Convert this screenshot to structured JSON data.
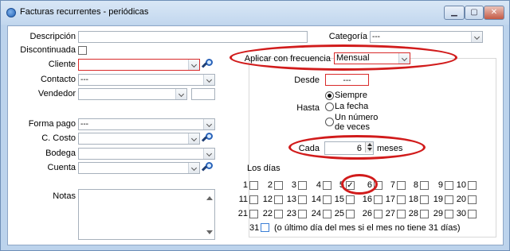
{
  "window": {
    "title": "Facturas recurrentes - periódicas"
  },
  "form": {
    "descripcion_label": "Descripción",
    "categoria_label": "Categoría",
    "categoria_value": "---",
    "discontinuada_label": "Discontinuada",
    "cliente_label": "Cliente",
    "contacto_label": "Contacto",
    "contacto_value": "---",
    "vendedor_label": "Vendedor",
    "forma_pago_label": "Forma pago",
    "forma_pago_value": "---",
    "costo_label": "C. Costo",
    "bodega_label": "Bodega",
    "cuenta_label": "Cuenta",
    "notas_label": "Notas"
  },
  "recurrence": {
    "frecuencia_label": "Aplicar con frecuencia",
    "frecuencia_value": "Mensual",
    "desde_label": "Desde",
    "desde_value": "---",
    "hasta_label": "Hasta",
    "opt_siempre": "Siempre",
    "opt_fecha": "La fecha",
    "opt_numero_1": "Un número",
    "opt_numero_2": "de veces",
    "cada_label": "Cada",
    "cada_value": "6",
    "cada_unit": "meses",
    "dias_label": "Los días",
    "days_row1": [
      "1",
      "2",
      "3",
      "4",
      "5",
      "6",
      "7",
      "8",
      "9",
      "10"
    ],
    "days_row2": [
      "11",
      "12",
      "13",
      "14",
      "15",
      "16",
      "17",
      "18",
      "19",
      "20"
    ],
    "days_row3": [
      "21",
      "22",
      "23",
      "24",
      "25",
      "26",
      "27",
      "28",
      "29",
      "30"
    ],
    "day31": "31",
    "day31_note": "(o último día del mes si el mes no tiene 31 días)",
    "checked_day": "5"
  }
}
